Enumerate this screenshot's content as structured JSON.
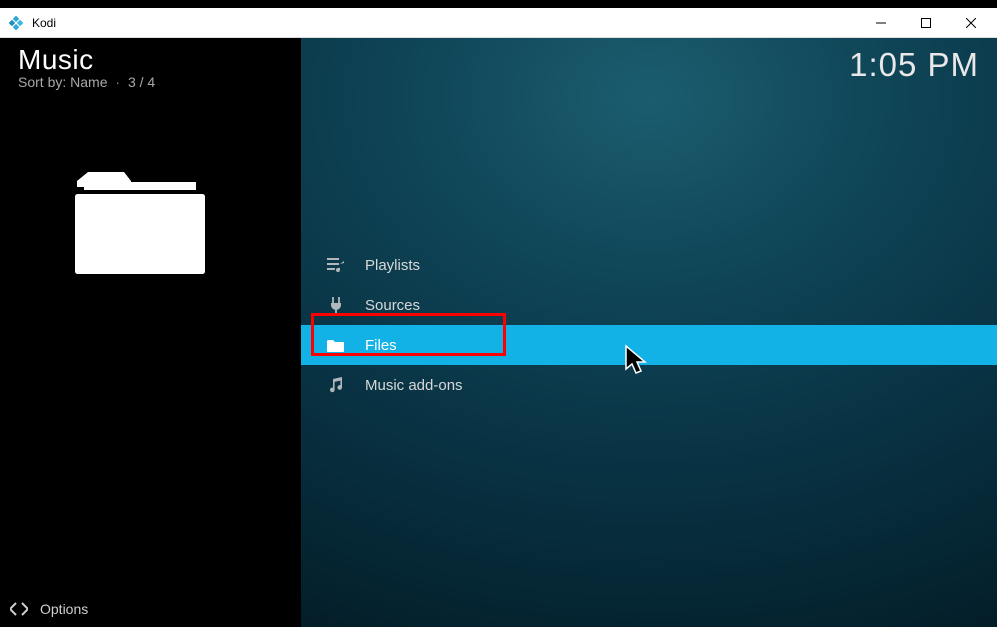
{
  "window": {
    "title": "Kodi"
  },
  "header": {
    "title": "Music",
    "sort_label": "Sort by:",
    "sort_value": "Name",
    "counter": "3 / 4"
  },
  "clock": "1:05 PM",
  "menu": {
    "items": [
      {
        "label": "Playlists",
        "icon": "playlist-icon",
        "selected": false
      },
      {
        "label": "Sources",
        "icon": "plug-icon",
        "selected": false
      },
      {
        "label": "Files",
        "icon": "folder-icon",
        "selected": true
      },
      {
        "label": "Music add-ons",
        "icon": "music-icon",
        "selected": false
      }
    ]
  },
  "bottom": {
    "options_label": "Options"
  }
}
